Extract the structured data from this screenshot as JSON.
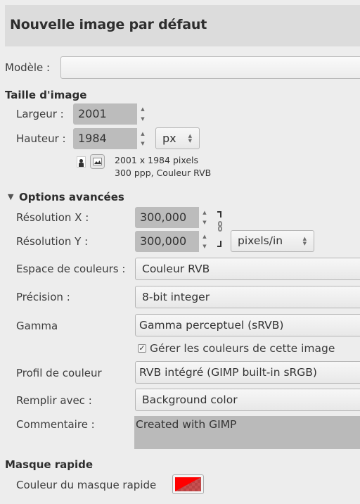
{
  "header": {
    "title": "Nouvelle image par défaut"
  },
  "template": {
    "label": "Modèle :",
    "value": ""
  },
  "image_size": {
    "section_title": "Taille d'image",
    "width_label": "Largeur :",
    "width_value": "2001",
    "height_label": "Hauteur :",
    "height_value": "1984",
    "unit": "px",
    "info_line1": "2001 x 1984 pixels",
    "info_line2": "300 ppp, Couleur RVB",
    "orientation_icons": [
      "portrait-icon",
      "landscape-icon"
    ]
  },
  "advanced": {
    "section_title": "Options avancées",
    "expanded": true,
    "res_x_label": "Résolution X :",
    "res_x_value": "300,000",
    "res_y_label": "Résolution Y :",
    "res_y_value": "300,000",
    "res_unit": "pixels/in",
    "colorspace_label": "Espace de couleurs :",
    "colorspace_value": "Couleur RVB",
    "precision_label": "Précision :",
    "precision_value": "8-bit integer",
    "gamma_label": "Gamma",
    "gamma_value": "Gamma perceptuel (sRVB)",
    "manage_colors_label": "Gérer les couleurs de cette image",
    "manage_colors_checked": true,
    "profile_label": "Profil de couleur",
    "profile_value": "RVB intégré (GIMP built-in sRGB)",
    "fill_label": "Remplir avec :",
    "fill_value": "Background color",
    "comment_label": "Commentaire :",
    "comment_value": "Created with GIMP"
  },
  "quick_mask": {
    "section_title": "Masque rapide",
    "color_label": "Couleur du masque rapide",
    "color": "#ff0000"
  }
}
